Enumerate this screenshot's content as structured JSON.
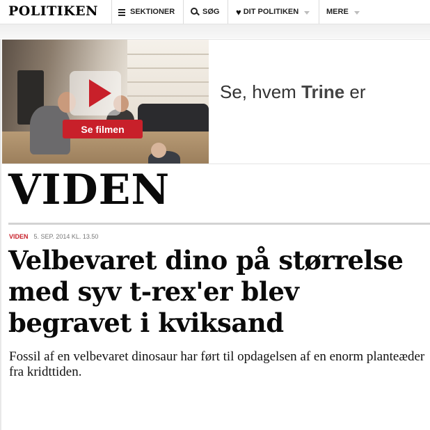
{
  "header": {
    "logo": "POLITIKEN",
    "nav": {
      "sections_label": "SEKTIONER",
      "search_label": "SØG",
      "my_politiken_label": "DIT POLITIKEN",
      "more_label": "MERE"
    }
  },
  "ad": {
    "button_label": "Se filmen",
    "text_prefix": "Se, hvem ",
    "text_bold": "Trine",
    "text_suffix": " er"
  },
  "section": {
    "title": "VIDEN"
  },
  "article": {
    "section_label": "VIDEN",
    "date": "5. SEP. 2014 KL. 13.50",
    "headline": "Velbevaret dino på størrelse med syv t-rex'er blev begravet i kviksand",
    "summary": "Fossil af en velbevaret dinosaur har ført til opdagelsen af en enorm planteæder fra kridttiden."
  },
  "colors": {
    "accent": "#c8202a",
    "text": "#0a0a0a"
  },
  "icons": [
    "hamburger-icon",
    "search-icon",
    "heart-icon",
    "chevron-down-icon",
    "play-icon"
  ]
}
